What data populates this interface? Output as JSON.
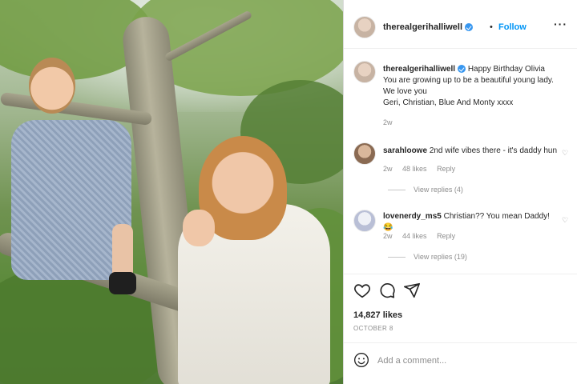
{
  "post": {
    "image_alt": "Photo of a girl in a tree next to a woman in white"
  },
  "header": {
    "username": "therealgerihalliwell",
    "separator": "•",
    "follow_label": "Follow",
    "more_icon": "more-horizontal-icon"
  },
  "caption": {
    "username": "therealgerihalliwell",
    "lines": [
      "Happy Birthday Olivia",
      "You are growing up to be a beautiful young lady.",
      "We love you",
      "Geri, Christian, Blue And Monty xxxx"
    ],
    "time": "2w"
  },
  "comments": [
    {
      "username": "sarahloowe",
      "text": "2nd wife vibes there - it's daddy hun",
      "time": "2w",
      "likes": "48 likes",
      "reply": "Reply",
      "view_replies": "View replies (4)"
    },
    {
      "username": "lovenerdy_ms5",
      "text": "Christian?? You mean Daddy!",
      "emoji": "😂",
      "time": "2w",
      "likes": "44 likes",
      "reply": "Reply",
      "view_replies": "View replies (19)"
    }
  ],
  "actions": {
    "like_icon": "heart-icon",
    "comment_icon": "comment-icon",
    "share_icon": "share-icon"
  },
  "likes": "14,827 likes",
  "date": "OCTOBER 8",
  "add_comment_placeholder": "Add a comment...",
  "colors": {
    "accent": "#0095f6",
    "verified": "#3897f0",
    "muted": "#8e8e8e"
  }
}
